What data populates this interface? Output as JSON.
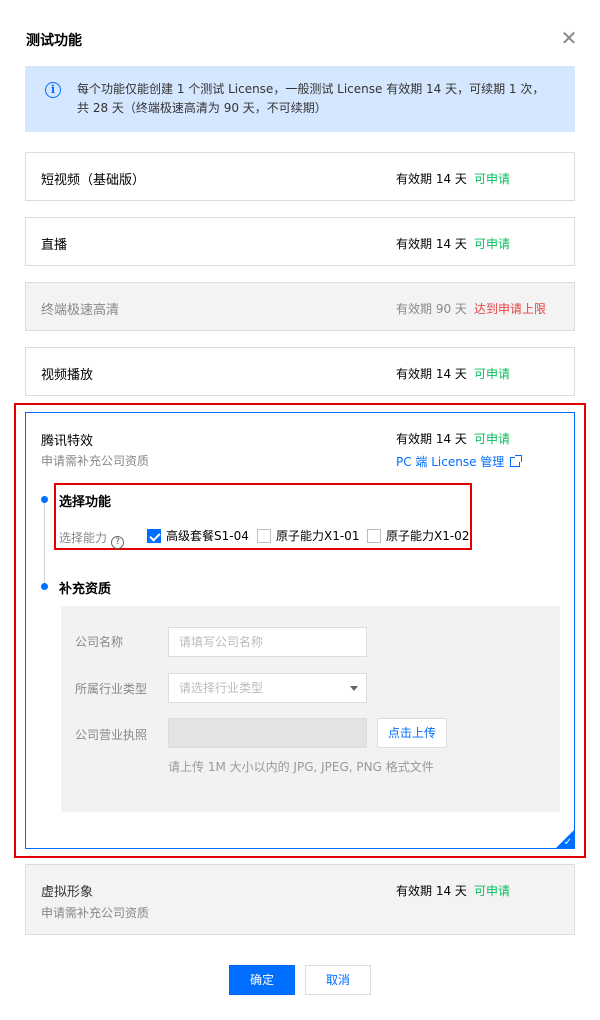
{
  "dialog": {
    "title": "测试功能",
    "close_symbol": "✕"
  },
  "notice": {
    "icon": "info-icon",
    "line1": "每个功能仅能创建 1 个测试 License，一般测试 License 有效期 14 天，可续期 1 次，",
    "line2": "共 28 天（终端极速高清为 90 天，不可续期）"
  },
  "features": [
    {
      "name": "短视频（基础版）",
      "validity": "有效期 14 天",
      "status": "可申请"
    },
    {
      "name": "直播",
      "validity": "有效期 14 天",
      "status": "可申请"
    },
    {
      "name": "终端极速高清",
      "validity": "有效期 90 天",
      "status": "达到申请上限"
    },
    {
      "name": "视频播放",
      "validity": "有效期 14 天",
      "status": "可申请"
    }
  ],
  "tencent_effects": {
    "name": "腾讯特效",
    "sub": "申请需补充公司资质",
    "validity": "有效期 14 天",
    "status": "可申请",
    "pc_link": "PC 端 License 管理",
    "step1_title": "选择功能",
    "ability_label": "选择能力",
    "options": [
      {
        "label": "高级套餐S1-04",
        "checked": true
      },
      {
        "label": "原子能力X1-01",
        "checked": false
      },
      {
        "label": "原子能力X1-02",
        "checked": false
      }
    ],
    "step2_title": "补充资质",
    "form": {
      "company_label": "公司名称",
      "company_placeholder": "请填写公司名称",
      "industry_label": "所属行业类型",
      "industry_placeholder": "请选择行业类型",
      "license_label": "公司营业执照",
      "upload_button": "点击上传",
      "upload_hint": "请上传 1M 大小以内的 JPG, JPEG, PNG 格式文件"
    }
  },
  "virtual_avatar": {
    "name": "虚拟形象",
    "sub": "申请需补充公司资质",
    "validity": "有效期 14 天",
    "status": "可申请"
  },
  "footer": {
    "confirm": "确定",
    "cancel": "取消"
  },
  "colors": {
    "primary": "#006eff",
    "success": "#0abf5b",
    "danger": "#e54545",
    "highlight": "#e20000"
  }
}
